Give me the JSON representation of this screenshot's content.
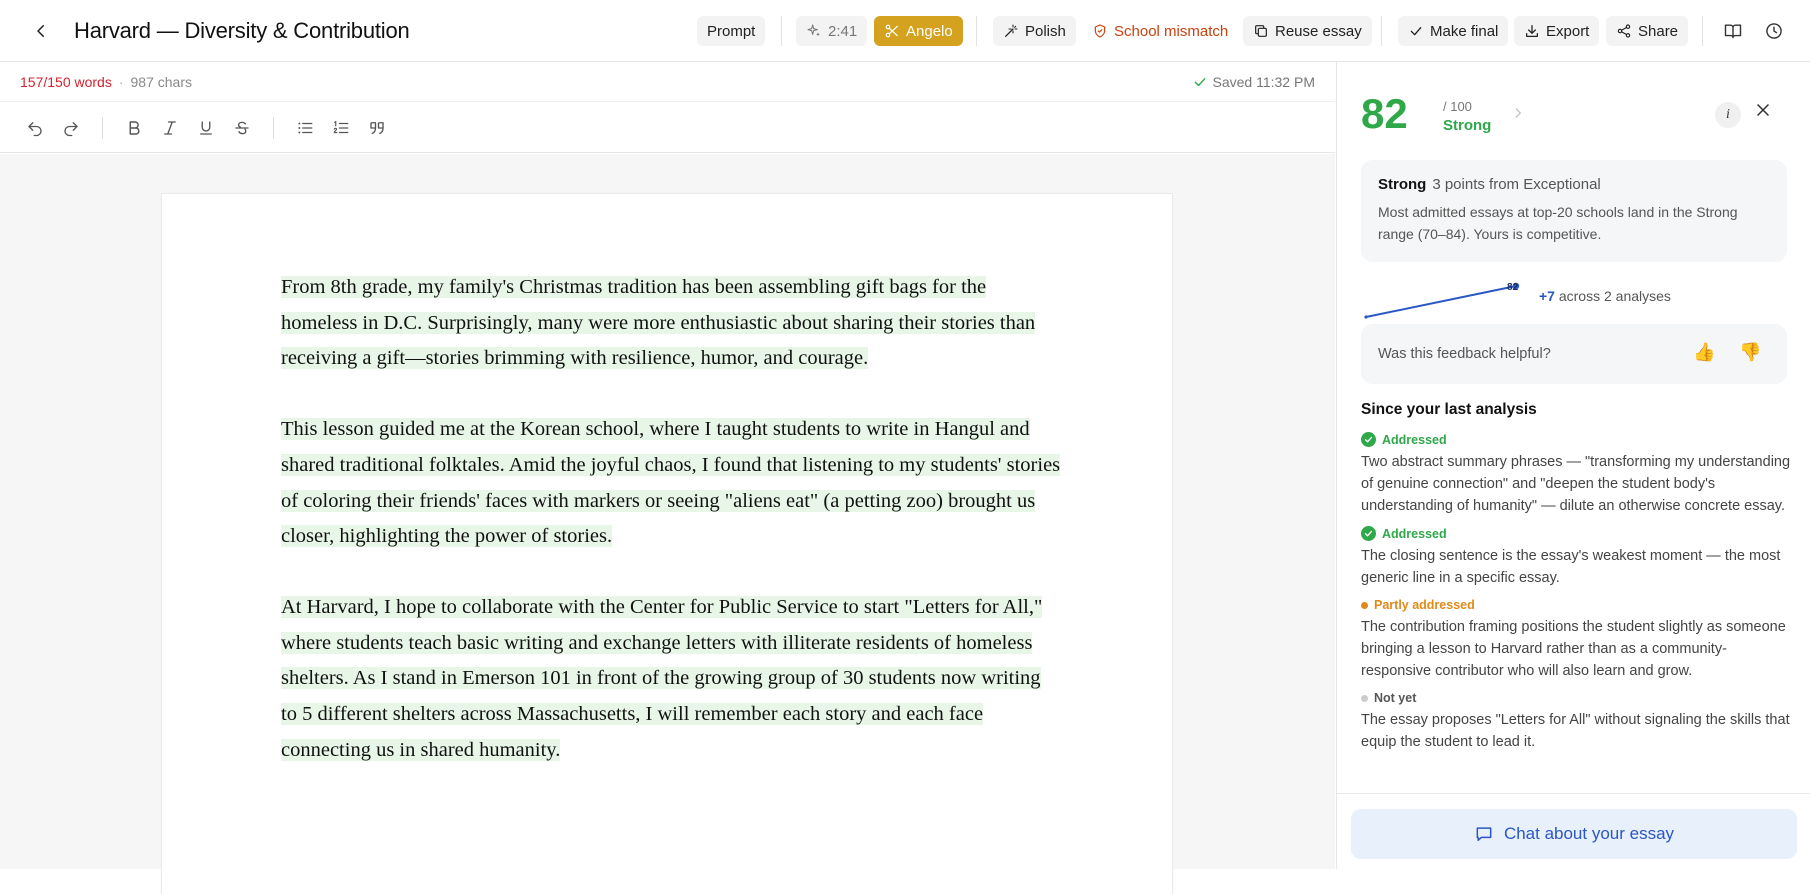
{
  "header": {
    "title": "Harvard — Diversity & Contribution",
    "prompt_label": "Prompt",
    "timer": "2:41",
    "persona_label": "Angelo",
    "polish_label": "Polish",
    "school_mismatch_label": "School mismatch",
    "reuse_label": "Reuse essay",
    "make_final_label": "Make final",
    "export_label": "Export",
    "share_label": "Share"
  },
  "status": {
    "word_count": "157/150 words",
    "separator": "·",
    "char_count": "987 chars",
    "saved": "Saved 11:32 PM"
  },
  "essay": {
    "paragraphs": [
      "From 8th grade, my family's Christmas tradition has been assembling gift bags for the homeless in D.C. Surprisingly, many were more enthusiastic about sharing their stories than receiving a gift—stories brimming with resilience, humor, and courage.",
      "This lesson guided me at the Korean school, where I taught students to write in Hangul and shared traditional folktales. Amid the joyful chaos, I found that listening to my students' stories of coloring their friends' faces with markers or seeing \"aliens eat\" (a petting zoo) brought us closer, highlighting the power of stories.",
      "At Harvard, I hope to collaborate with the Center for Public Service to start \"Letters for All,\" where students teach basic writing and exchange letters with illiterate residents of homeless shelters. As I stand in Emerson 101 in front of the growing group of 30 students now writing to 5 different shelters across Massachusetts, I will remember each story and each face connecting us in shared humanity."
    ]
  },
  "panel": {
    "score": "82",
    "score_max": "/ 100",
    "score_label": "Strong",
    "info_label": "i",
    "verdict_title": "Strong",
    "verdict_subtitle": "3 points from Exceptional",
    "verdict_body": "Most admitted essays at top-20 schools land in the Strong range (70–84). Yours is competitive.",
    "trend_point_label": "82",
    "trend_delta": "+7",
    "trend_text": "across 2 analyses",
    "helpful_question": "Was this feedback helpful?",
    "thumbs_up": "👍",
    "thumbs_down": "👎",
    "since_title": "Since your last analysis",
    "items": [
      {
        "status": "Addressed",
        "text": "Two abstract summary phrases — \"transforming my understanding of genuine connection\" and \"deepen the student body's understanding of humanity\" — dilute an otherwise concrete essay."
      },
      {
        "status": "Addressed",
        "text": "The closing sentence is the essay's weakest moment — the most generic line in a specific essay."
      },
      {
        "status": "Partly addressed",
        "text": "The contribution framing positions the student slightly as someone bringing a lesson to Harvard rather than as a community-responsive contributor who will also learn and grow."
      },
      {
        "status": "Not yet",
        "text": "The essay proposes \"Letters for All\" without signaling the skills that equip the student to lead it."
      }
    ],
    "chat_label": "Chat about your essay"
  },
  "colors": {
    "score_green": "#2fa84a",
    "accent_blue": "#2a57c4",
    "persona_gold": "#d5a21f",
    "warning_red": "#c9410f",
    "word_count_red": "#d4232f",
    "partly_orange": "#e08a1a",
    "highlight_green": "#e8f6e8"
  }
}
